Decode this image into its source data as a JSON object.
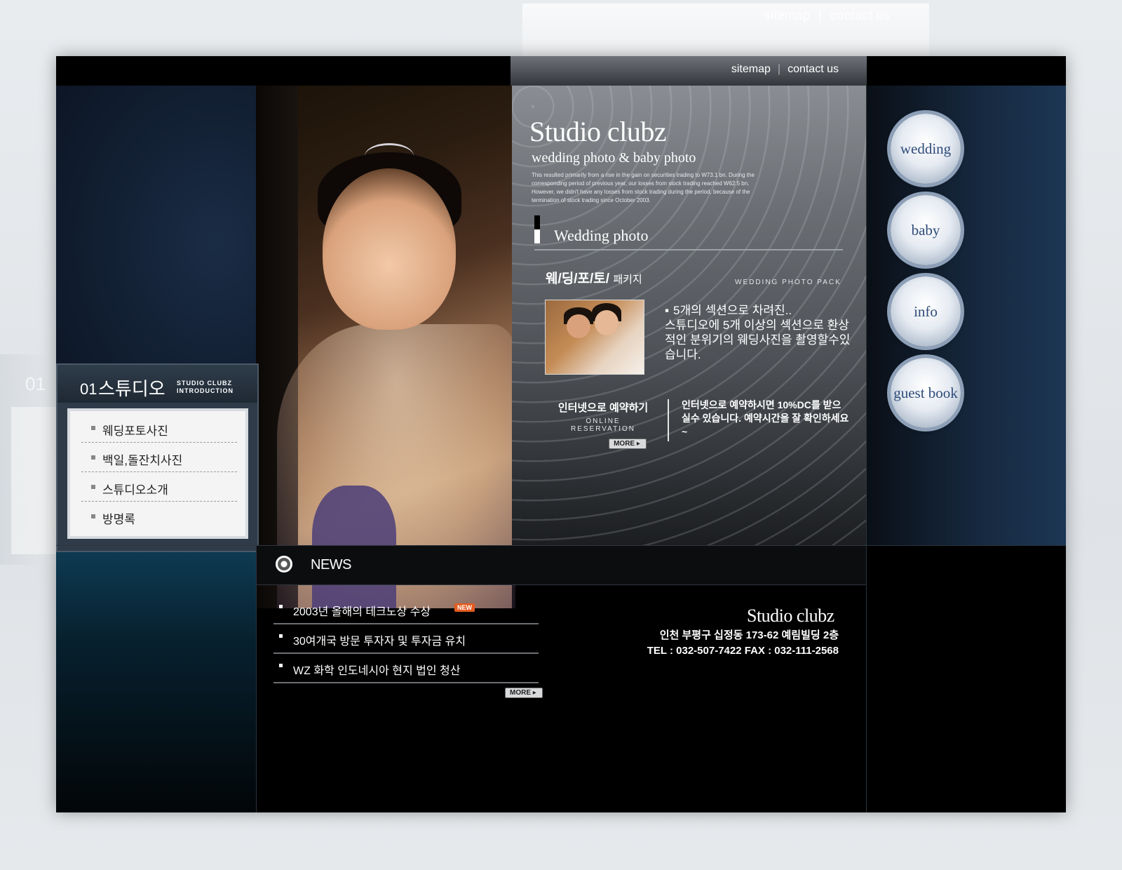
{
  "background": {
    "links": [
      "sitemap",
      "contact us"
    ],
    "ghost_number": "01"
  },
  "topnav": {
    "sitemap": "sitemap",
    "contact": "contact us"
  },
  "panel": {
    "title": "Studio clubz",
    "subtitle": "wedding photo & baby photo",
    "description": "This resulted primarily from a rise in the gain on securities trading to W73.1 bn. During the corresponding period of previous year, our losses from stock trading reached W62.5 bn. However, we didn't have any losses from stock trading during the period, because of the termination of stock trading since October 2003.",
    "section_title": "Wedding photo",
    "package_title": "웨/딩/포/토/",
    "package_suffix": "패키지",
    "package_eng": "WEDDING PHOTO PACK",
    "package_bullet": "5개의 섹션으로 차려진..",
    "package_desc": "스튜디오에 5개 이상의 섹션으로 환상적인 분위기의 웨딩사진을 촬영할수있습니다.",
    "reserve_ko": "인터넷으로 예약하기",
    "reserve_en": "ONLINE RESERVATION",
    "more": "MORE",
    "reserve_text": "인터넷으로 예약하시면 10%DC를 받으실수 있습니다. 예약시간을 잘 확인하세요~"
  },
  "right_nav": [
    {
      "label": "wedding"
    },
    {
      "label": "baby"
    },
    {
      "label": "info"
    },
    {
      "label": "guest book"
    }
  ],
  "studio_menu": {
    "number": "01",
    "title": "스튜디오",
    "eng_line1": "STUDIO CLUBZ",
    "eng_line2": "INTRODUCTION",
    "items": [
      "웨딩포토사진",
      "백일,돌잔치사진",
      "스튜디오소개",
      "방명록"
    ]
  },
  "news": {
    "title": "NEWS",
    "items": [
      {
        "text": "2003년 올해의 테크노상 수상",
        "badge": "NEW"
      },
      {
        "text": "30여개국 방문 투자자 및 투자금 유치",
        "badge": ""
      },
      {
        "text": "WZ 화학 인도네시아 현지 법인 청산",
        "badge": ""
      }
    ],
    "more": "MORE"
  },
  "footer": {
    "brand": "Studio clubz",
    "address": "인천 부평구 십정동 173-62 예림빌딩 2층",
    "contact": "TEL : 032-507-7422   FAX : 032-111-2568"
  }
}
